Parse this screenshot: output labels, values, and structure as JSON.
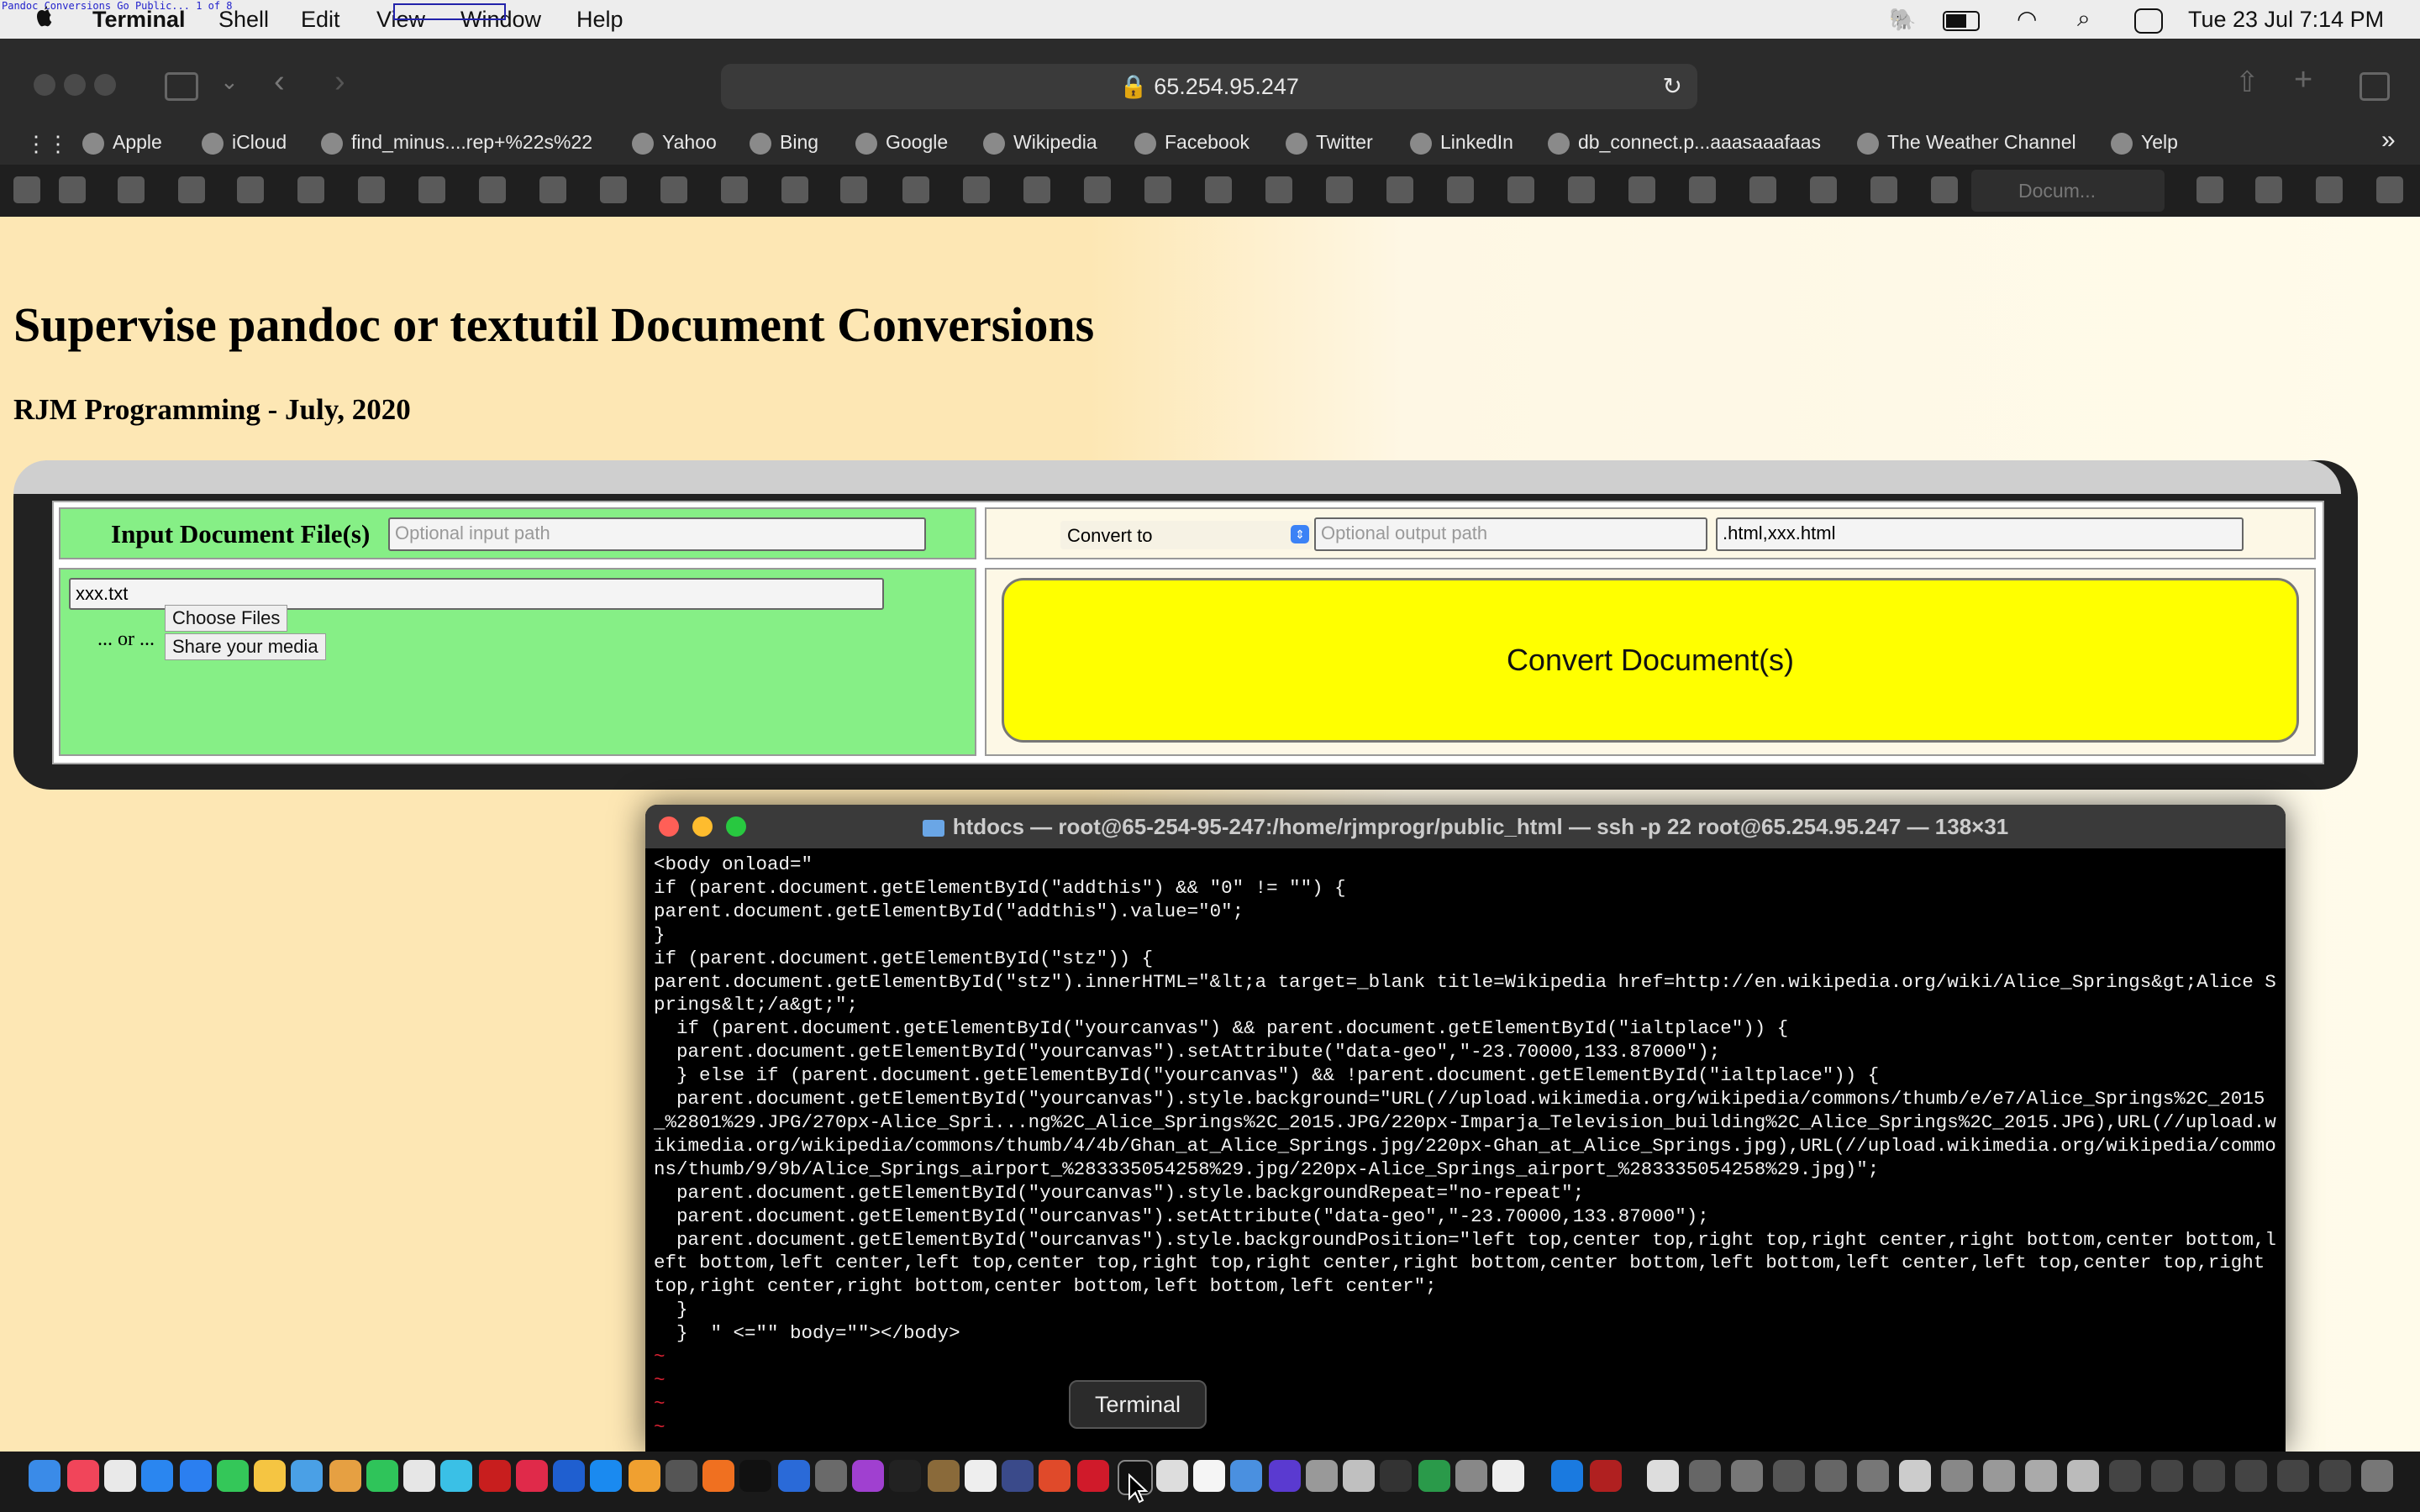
{
  "menubar": {
    "tiny_title": "Pandoc Conversions Go Public... 1 of 8",
    "items": [
      "Terminal",
      "Shell",
      "Edit",
      "View",
      "Window",
      "Help"
    ],
    "clock": "Tue 23 Jul  7:14 PM"
  },
  "browser": {
    "url": "65.254.95.247",
    "bookmarks": [
      "Apple",
      "iCloud",
      "find_minus....rep+%22s%22",
      "Yahoo",
      "Bing",
      "Google",
      "Wikipedia",
      "Facebook",
      "Twitter",
      "LinkedIn",
      "db_connect.p...aaasaaafaas",
      "The Weather Channel",
      "Yelp"
    ],
    "active_tab": "Docum..."
  },
  "page": {
    "title": "Supervise pandoc or textutil Document Conversions",
    "subtitle": "RJM Programming - July, 2020",
    "input_label": "Input Document File(s)",
    "input_path_placeholder": "Optional input path",
    "convert_select": "Convert to",
    "output_path_placeholder": "Optional output path",
    "output_ext_value": ".html,xxx.html",
    "file_value": "xxx.txt",
    "or_text": "... or ...",
    "choose_files": "Choose Files",
    "share_media": "Share your media",
    "convert_button": "Convert Document(s)"
  },
  "terminal": {
    "title": "htdocs — root@65-254-95-247:/home/rjmprogr/public_html — ssh -p 22 root@65.254.95.247 — 138×31",
    "content": "<body onload=\"\nif (parent.document.getElementById(\"addthis\") && \"0\" != \"\") {\nparent.document.getElementById(\"addthis\").value=\"0\";\n}\nif (parent.document.getElementById(\"stz\")) {\nparent.document.getElementById(\"stz\").innerHTML=\"&lt;a target=_blank title=Wikipedia href=http://en.wikipedia.org/wiki/Alice_Springs&gt;Alice Springs&lt;/a&gt;\";\n  if (parent.document.getElementById(\"yourcanvas\") && parent.document.getElementById(\"ialtplace\")) {\n  parent.document.getElementById(\"yourcanvas\").setAttribute(\"data-geo\",\"-23.70000,133.87000\");\n  } else if (parent.document.getElementById(\"yourcanvas\") && !parent.document.getElementById(\"ialtplace\")) {\n  parent.document.getElementById(\"yourcanvas\").style.background=\"URL(//upload.wikimedia.org/wikipedia/commons/thumb/e/e7/Alice_Springs%2C_2015_%2801%29.JPG/270px-Alice_Spri...ng%2C_Alice_Springs%2C_2015.JPG/220px-Imparja_Television_building%2C_Alice_Springs%2C_2015.JPG),URL(//upload.wikimedia.org/wikipedia/commons/thumb/4/4b/Ghan_at_Alice_Springs.jpg/220px-Ghan_at_Alice_Springs.jpg),URL(//upload.wikimedia.org/wikipedia/commons/thumb/9/9b/Alice_Springs_airport_%283335054258%29.jpg/220px-Alice_Springs_airport_%283335054258%29.jpg)\";\n  parent.document.getElementById(\"yourcanvas\").style.backgroundRepeat=\"no-repeat\";\n  parent.document.getElementById(\"ourcanvas\").setAttribute(\"data-geo\",\"-23.70000,133.87000\");\n  parent.document.getElementById(\"ourcanvas\").style.backgroundPosition=\"left top,center top,right top,right center,right bottom,center bottom,left bottom,left center,left top,center top,right top,right center,right bottom,center bottom,left bottom,left center,left top,center top,right top,right center,right bottom,center bottom,left bottom,left center\";\n  }\n  }  \" <=\"\" body=\"\"></body>",
    "tildes": [
      "~",
      "~",
      "~",
      "~"
    ]
  },
  "dock": {
    "tooltip": "Terminal"
  }
}
